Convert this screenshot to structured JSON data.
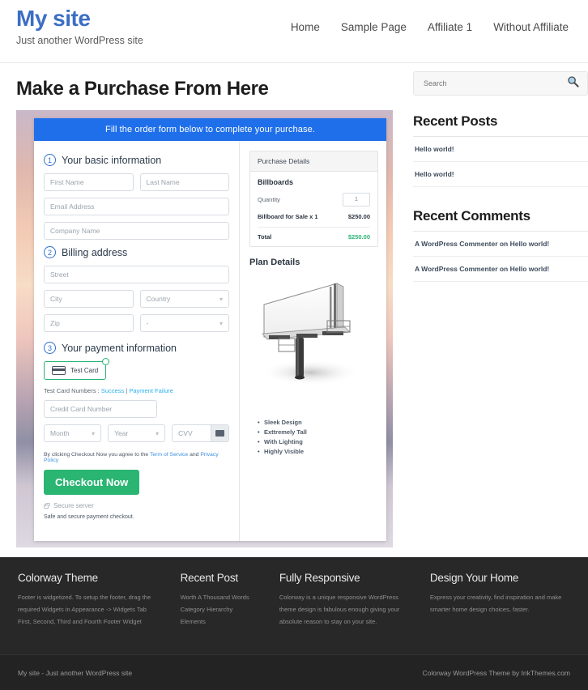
{
  "header": {
    "site_title": "My site",
    "tagline": "Just another WordPress site",
    "nav": [
      {
        "label": "Home"
      },
      {
        "label": "Sample Page"
      },
      {
        "label": "Affiliate 1"
      },
      {
        "label": "Without Affiliate"
      }
    ]
  },
  "main": {
    "page_title": "Make a Purchase From Here",
    "banner": "Fill the order form below to complete your purchase.",
    "steps": {
      "one_num": "1",
      "one_title": "Your basic information",
      "two_num": "2",
      "two_title": "Billing address",
      "three_num": "3",
      "three_title": "Your payment information"
    },
    "fields": {
      "first_name": "First Name",
      "last_name": "Last Name",
      "email": "Email Address",
      "company": "Company Name",
      "street": "Street",
      "city": "City",
      "country": "Country",
      "zip": "Zip",
      "state": "-",
      "credit_card": "Credit Card Number",
      "month": "Month",
      "year": "Year",
      "cvv": "CVV"
    },
    "payment": {
      "card_badge_label": "Test  Card",
      "test_prefix": "Test Card Numbers : ",
      "test_success": "Success",
      "test_sep": " | ",
      "test_failure": "Payment Failure",
      "terms_prefix": "By clicking Checkout Now you agree to the ",
      "terms_tos": "Term of Service",
      "terms_and": " and ",
      "terms_privacy": "Privacy Policy",
      "checkout_label": "Checkout Now",
      "secure_server": "Secure server",
      "safe_note": "Safe and secure payment checkout."
    },
    "purchase_details": {
      "heading": "Purchase Details",
      "product": "Billboards",
      "quantity_label": "Quantity",
      "quantity_value": "1",
      "line_item_label": "Billboard for Sale x 1",
      "line_item_price": "$250.00",
      "total_label": "Total",
      "total_price": "$250.00"
    },
    "plan": {
      "title": "Plan Details",
      "features": [
        "Sleek Design",
        "Exttremely Tall",
        "With Lighting",
        "Highly Visible"
      ]
    }
  },
  "sidebar": {
    "search_placeholder": "Search",
    "recent_posts_title": "Recent Posts",
    "recent_posts": [
      "Hello world!",
      "Hello world!"
    ],
    "recent_comments_title": "Recent Comments",
    "recent_comments": [
      "A WordPress Commenter on Hello world!",
      "A WordPress Commenter on Hello world!"
    ]
  },
  "footer": {
    "widgets": [
      {
        "title": "Colorway Theme",
        "lines": [
          "Footer is widgetized. To setup the footer, drag the",
          "required Widgets in Appearance -> Widgets Tab",
          "First, Second, Third and Fourth Footer Widget"
        ]
      },
      {
        "title": "Recent Post",
        "lines": [
          "Worth A Thousand Words",
          "Category Hierarchy",
          "Elements"
        ]
      },
      {
        "title": "Fully Responsive",
        "lines": [
          "Colorway is a unique responsive WordPress",
          "theme design is fabulous enough giving your",
          "absolute reason to stay on your site."
        ]
      },
      {
        "title": "Design Your Home",
        "lines": [
          "Express your creativity, find inspiration and make",
          "smarter home design choices, faster."
        ]
      }
    ],
    "copyright_left": "My site - Just another WordPress site",
    "copyright_right": "Colorway WordPress Theme by InkThemes.com"
  },
  "colors": {
    "brand_blue": "#3b6ec4",
    "banner_blue": "#1f6feb",
    "success_green": "#2ab573",
    "link_blue": "#29b0ef"
  }
}
